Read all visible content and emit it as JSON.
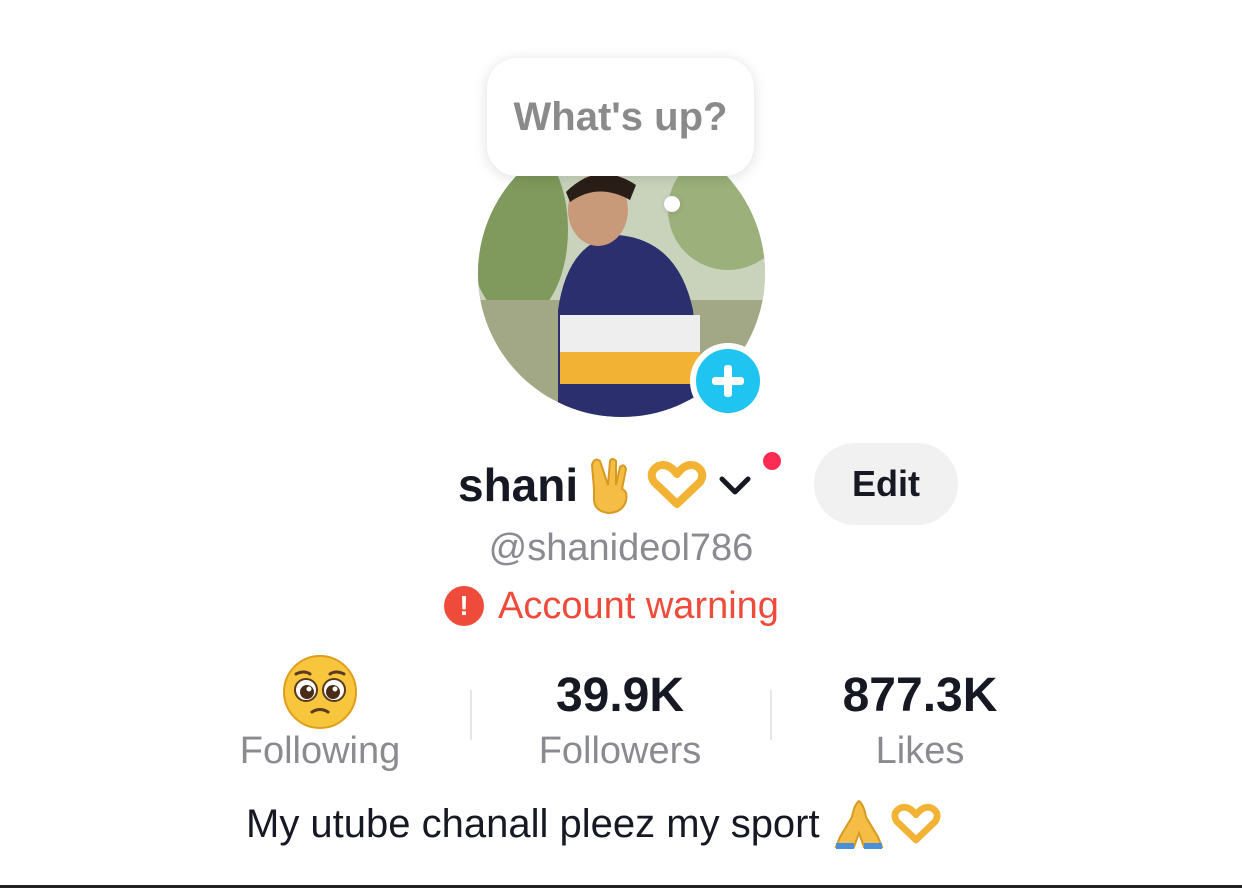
{
  "profile": {
    "status_bubble": "What's up?",
    "display_name": "shani",
    "username": "@shanideol786",
    "edit_label": "Edit",
    "warning_label": "Account warning",
    "bio": "My utube chanall pleez my sport"
  },
  "stats": [
    {
      "value": "",
      "emoji": "pleading-face-emoji",
      "label": "Following"
    },
    {
      "value": "39.9K",
      "label": "Followers"
    },
    {
      "value": "877.3K",
      "label": "Likes"
    }
  ],
  "colors": {
    "accent_add": "#20c4f0",
    "warning": "#ee4b3a",
    "notification_dot": "#fe2c55",
    "text_primary": "#161823",
    "text_secondary": "#8a8b91"
  },
  "icons": [
    "victory-hand-icon",
    "heart-hands-icon",
    "chevron-down-icon",
    "plus-icon",
    "exclamation-icon",
    "folded-hands-icon"
  ]
}
